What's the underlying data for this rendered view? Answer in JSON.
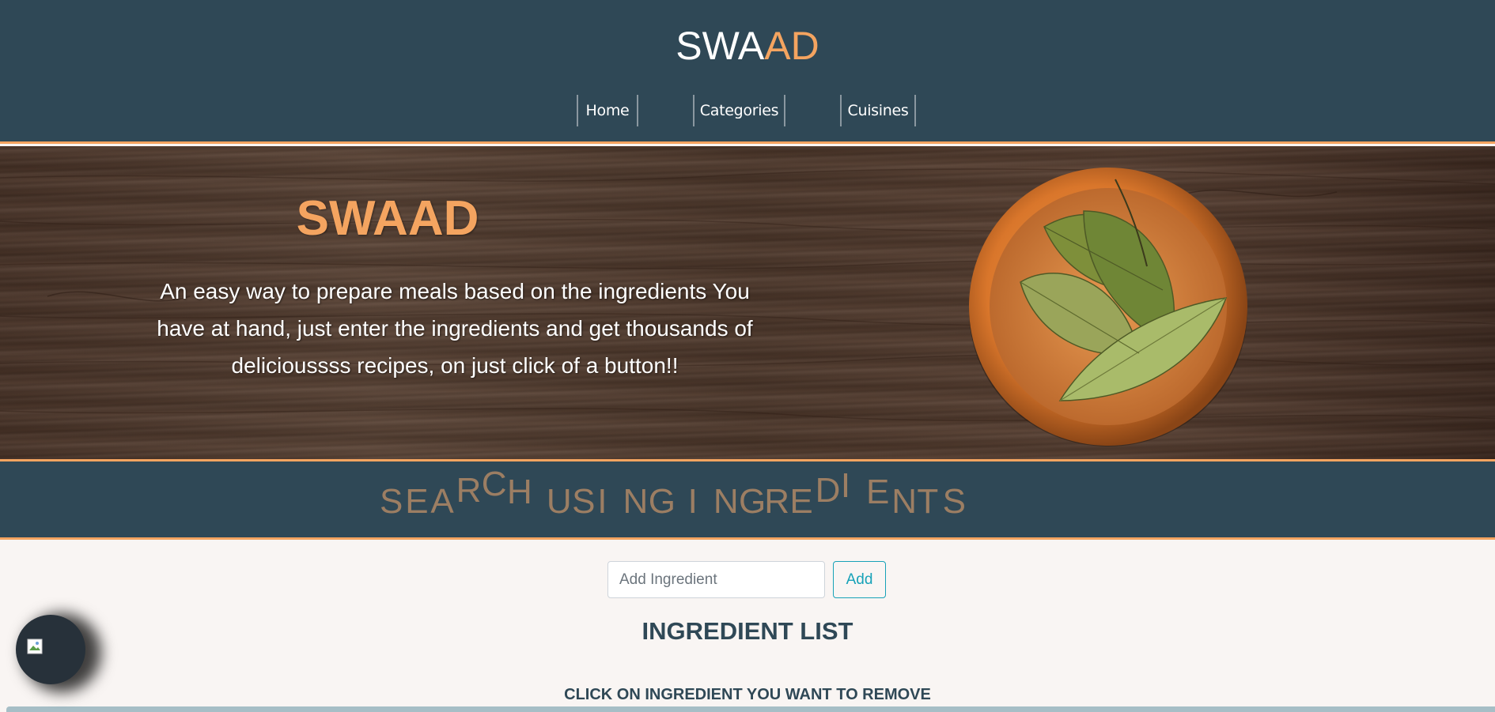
{
  "header": {
    "brand_part1": "SWA",
    "brand_part2": "AD",
    "nav": [
      {
        "label": "Home"
      },
      {
        "label": "Categories"
      },
      {
        "label": "Cuisines"
      }
    ]
  },
  "hero": {
    "title": "SWAAD",
    "description": "An easy way to prepare meals based on the ingredients You have at hand, just enter the ingredients and get thousands of delicioussss recipes, on just click of a button!!"
  },
  "search_banner": {
    "text": "SEARCH USING INGREDIENTS"
  },
  "ingredient_form": {
    "placeholder": "Add Ingredient",
    "value": "",
    "add_label": "Add"
  },
  "ingredient_list": {
    "title": "INGREDIENT LIST",
    "hint": "CLICK ON INGREDIENT YOU WANT TO REMOVE"
  },
  "colors": {
    "header_bg": "#2f4856",
    "accent": "#f4a460",
    "page_bg": "#f9f5f3",
    "button_outline": "#17a2b8",
    "banner_letter": "#9c7e63"
  },
  "icons": {
    "chat_fab": "broken-image-icon"
  }
}
